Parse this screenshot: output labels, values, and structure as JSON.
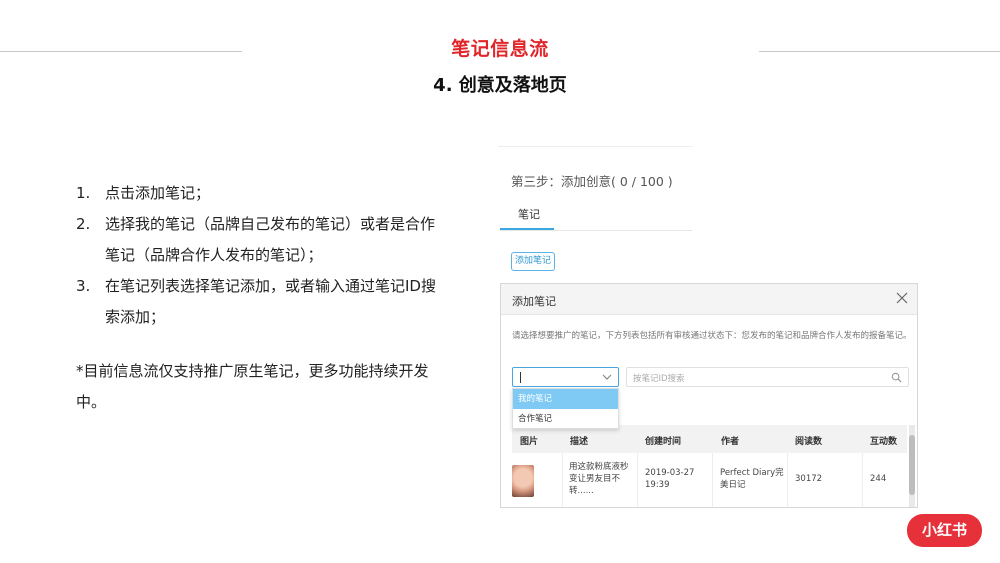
{
  "header": {
    "title": "笔记信息流",
    "subtitle": "4. 创意及落地页",
    "accent_color": "#e0262a"
  },
  "steps": [
    {
      "num": "1.",
      "text": "点击添加笔记；"
    },
    {
      "num": "2.",
      "text": "选择我的笔记（品牌自己发布的笔记）或者是合作笔记（品牌合作人发布的笔记）；"
    },
    {
      "num": "3.",
      "text": "在笔记列表选择笔记添加，或者输入通过笔记ID搜索添加；"
    }
  ],
  "note": "*目前信息流仅支持推广原生笔记，更多功能持续开发中。",
  "screenshot": {
    "step_title": "第三步：添加创意( 0 / 100 )",
    "tab_label": "笔记",
    "add_button": "添加笔记",
    "modal": {
      "title": "添加笔记",
      "close_icon": "close-icon",
      "description": "请选择想要推广的笔记，下方列表包括所有审核通过状态下：您发布的笔记和品牌合作人发布的报备笔记。",
      "select_value": "",
      "search_placeholder": "按笔记ID搜索",
      "dropdown_options": [
        "我的笔记",
        "合作笔记"
      ],
      "table": {
        "headers": [
          "图片",
          "描述",
          "创建时间",
          "作者",
          "阅读数",
          "互动数"
        ],
        "rows": [
          {
            "description": "用这款粉底液秒变让男友目不转......",
            "created": "2019-03-27 19:39",
            "author": "Perfect Diary完美日记",
            "reads": "30172",
            "interactions": "244"
          }
        ]
      }
    }
  },
  "logo_text": "小红书",
  "logo_color": "#e6303a"
}
